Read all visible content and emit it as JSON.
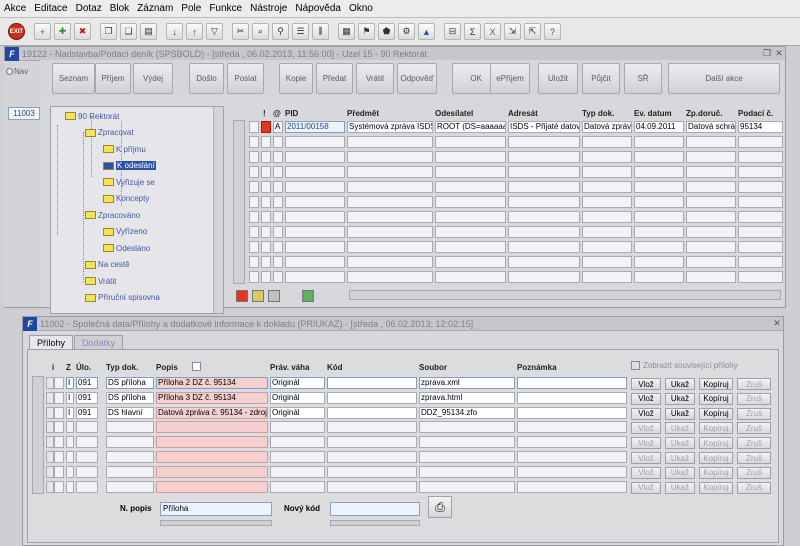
{
  "menu": [
    "Akce",
    "Editace",
    "Dotaz",
    "Blok",
    "Záznam",
    "Pole",
    "Funkce",
    "Nástroje",
    "Nápověda",
    "Okno"
  ],
  "toolbar": {
    "exit_label": "EXIT"
  },
  "win1": {
    "title": "19122 - Nadstavba/Podací deník (SPSBOLD) - [středa , 06.02.2013, 11:56:00] - Uzel 15 - 90 Rektorát",
    "nav_label": "Nav",
    "record_id": "11003"
  },
  "actions": [
    "Seznam",
    "Příjem",
    "Výdej",
    "Došlo",
    "Poslat",
    "Kopie",
    "Předat",
    "Vrátit",
    "Odpověď",
    "OK",
    "ePříjem",
    "Uložit",
    "Půjčit",
    "SŘ",
    "Další akce"
  ],
  "tree": [
    {
      "label": "90 Rektorát",
      "level": 0
    },
    {
      "label": "Zpracovat",
      "level": 1
    },
    {
      "label": "K příjmu",
      "level": 2
    },
    {
      "label": "K odeslání",
      "level": 2,
      "selected": true
    },
    {
      "label": "Vyřizuje se",
      "level": 2
    },
    {
      "label": "Koncepty",
      "level": 2
    },
    {
      "label": "Zpracováno",
      "level": 1
    },
    {
      "label": "Vyřízeno",
      "level": 2
    },
    {
      "label": "Odesláno",
      "level": 2
    },
    {
      "label": "Na cestě",
      "level": 1
    },
    {
      "label": "Vrátit",
      "level": 1
    },
    {
      "label": "Příruční spisovna",
      "level": 1
    }
  ],
  "grid1": {
    "headers": {
      "flag": "!",
      "attach": "@",
      "pid": "PID",
      "predmet": "Předmět",
      "odesilatel": "Odesílatel",
      "adresat": "Adresát",
      "typ": "Typ dok.",
      "ev": "Ev. datum",
      "zp": "Zp.doruč.",
      "podaci": "Podací č."
    },
    "rows": [
      {
        "a": "A",
        "pid": "2011/00158",
        "predmet": "Systémová zpráva ISDS",
        "odesilatel": "ROOT (DS=aaaaaa)",
        "adresat": "ISDS - Přijaté datové",
        "typ": "Datová zpráva",
        "ev": "04.09.2011",
        "zp": "Datová schránka",
        "podaci": "95134"
      }
    ]
  },
  "win2": {
    "title": "11002 - Společná data/Přílohy a dodatkové informace k dokladu (PRIUKAZ) - [středa , 06.02.2013; 12:02:15]",
    "tabs": [
      "Přílohy",
      "Dodatky"
    ]
  },
  "grid2": {
    "headers": {
      "i": "i",
      "z": "Z",
      "ulo": "Úlo.",
      "typ": "Typ dok.",
      "popis": "Popis",
      "prav": "Práv. váha",
      "kod": "Kód",
      "soubor": "Soubor",
      "pozn": "Poznámka"
    },
    "show_related": "Zobrazit související přílohy",
    "rows": [
      {
        "z": "I",
        "ulo": "091",
        "typ": "DS příloha",
        "popis": "Příloha 2 DZ č. 95134",
        "prav": "Originál",
        "kod": "",
        "soubor": "zprava.xml"
      },
      {
        "z": "I",
        "ulo": "091",
        "typ": "DS příloha",
        "popis": "Příloha 3 DZ č. 95134",
        "prav": "Originál",
        "kod": "",
        "soubor": "zprava.html"
      },
      {
        "z": "I",
        "ulo": "091",
        "typ": "DS hlavní",
        "popis": "Datová zpráva č. 95134 - zdroj",
        "prav": "Originál",
        "kod": "",
        "soubor": "DDZ_95134.zfo"
      }
    ],
    "row_buttons": [
      "Vlož",
      "Ukaž",
      "Kopíruj",
      "Zruš"
    ]
  },
  "bottom": {
    "n_popis_label": "N. popis",
    "n_popis_value": "Příloha",
    "novy_kod_label": "Nový kód",
    "novy_kod_value": ""
  }
}
